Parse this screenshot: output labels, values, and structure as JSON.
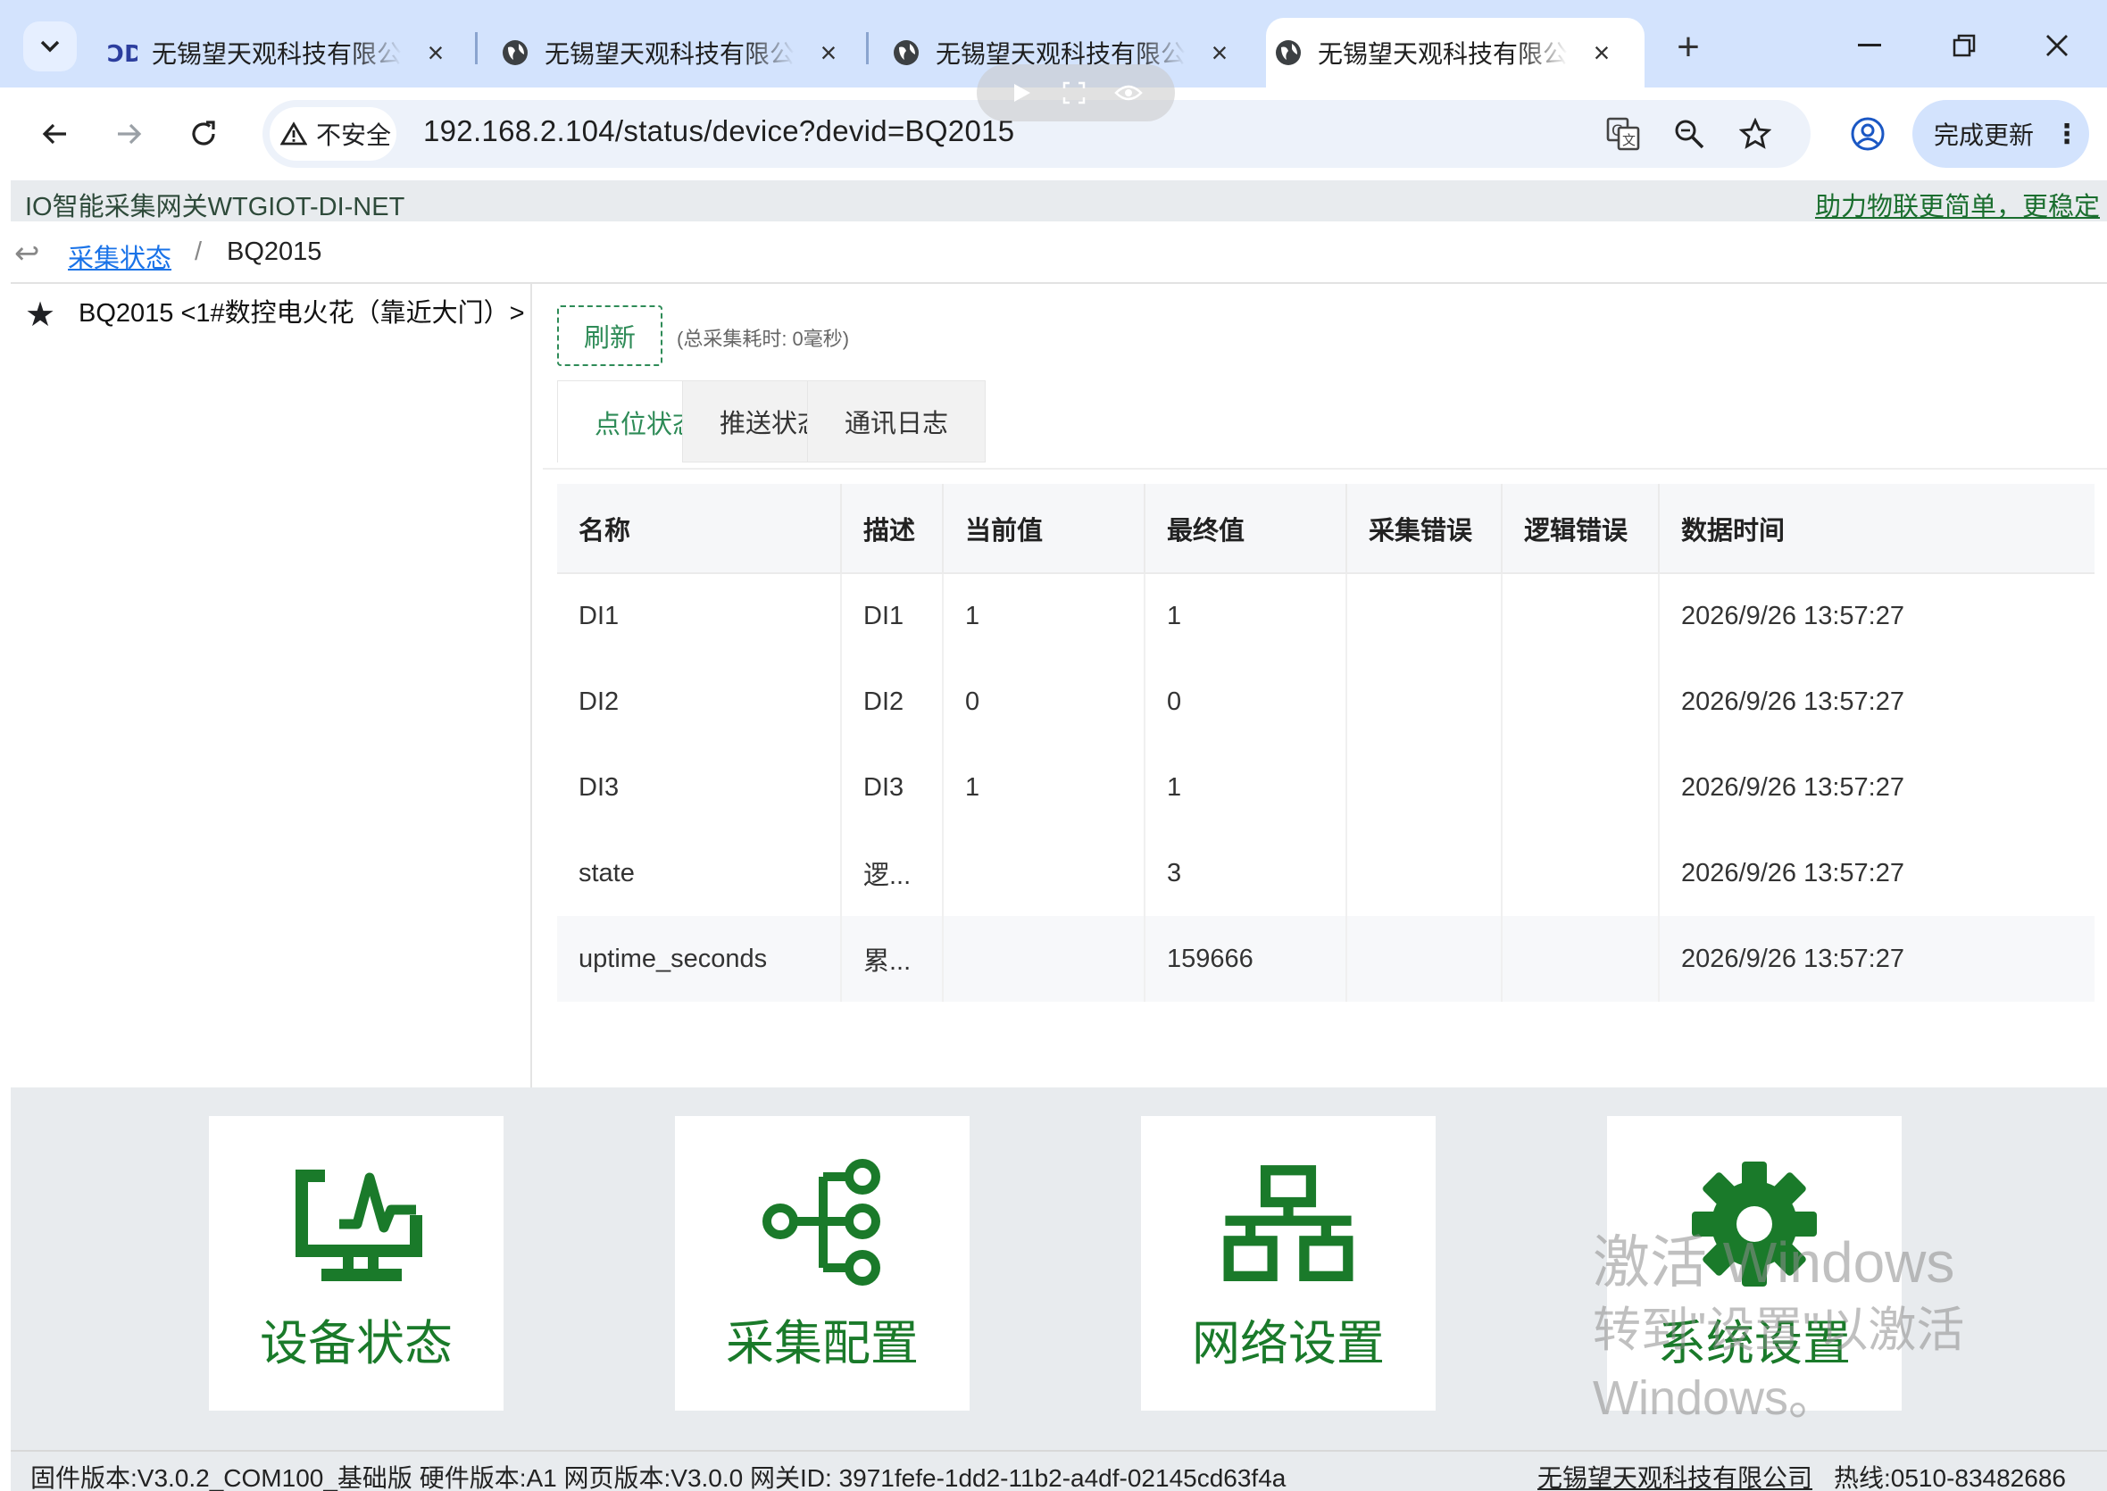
{
  "browser": {
    "tabs": [
      {
        "title": "无锡望天观科技有限公司",
        "active": false
      },
      {
        "title": "无锡望天观科技有限公司",
        "active": false
      },
      {
        "title": "无锡望天观科技有限公司",
        "active": false
      },
      {
        "title": "无锡望天观科技有限公司",
        "active": true
      }
    ],
    "security_label": "不安全",
    "url": "192.168.2.104/status/device?devid=BQ2015",
    "update_label": "完成更新"
  },
  "header": {
    "brand": "IO智能采集网关WTGIOT-DI-NET",
    "slogan": "助力物联更简单，更稳定"
  },
  "breadcrumb": {
    "link": "采集状态",
    "separator": "/",
    "current": "BQ2015"
  },
  "sidebar": {
    "device": "BQ2015 <1#数控电火花（靠近大门）>"
  },
  "toolbar": {
    "refresh_label": "刷新",
    "timing": "(总采集耗时: 0毫秒)"
  },
  "tabs": [
    "点位状态",
    "推送状态",
    "通讯日志"
  ],
  "table": {
    "columns": [
      "名称",
      "描述",
      "当前值",
      "最终值",
      "采集错误",
      "逻辑错误",
      "数据时间"
    ],
    "rows": [
      {
        "name": "DI1",
        "desc": "DI1",
        "current": "1",
        "final": "1",
        "collect_err": "",
        "logic_err": "",
        "time": "2026/9/26 13:57:27"
      },
      {
        "name": "DI2",
        "desc": "DI2",
        "current": "0",
        "final": "0",
        "collect_err": "",
        "logic_err": "",
        "time": "2026/9/26 13:57:27"
      },
      {
        "name": "DI3",
        "desc": "DI3",
        "current": "1",
        "final": "1",
        "collect_err": "",
        "logic_err": "",
        "time": "2026/9/26 13:57:27"
      },
      {
        "name": "state",
        "desc": "逻...",
        "current": "",
        "final": "3",
        "collect_err": "",
        "logic_err": "",
        "time": "2026/9/26 13:57:27"
      },
      {
        "name": "uptime_seconds",
        "desc": "累...",
        "current": "",
        "final": "159666",
        "collect_err": "",
        "logic_err": "",
        "time": "2026/9/26 13:57:27"
      }
    ]
  },
  "tiles": [
    {
      "label": "设备状态",
      "icon": "monitor-pulse-icon"
    },
    {
      "label": "采集配置",
      "icon": "node-tree-icon"
    },
    {
      "label": "网络设置",
      "icon": "network-icon"
    },
    {
      "label": "系统设置",
      "icon": "gear-icon"
    }
  ],
  "watermark": {
    "line1": "激活 Windows",
    "line2": "转到\"设置\"以激活",
    "line3": "Windows。"
  },
  "footer": {
    "versions": "固件版本:V3.0.2_COM100_基础版  硬件版本:A1  网页版本:V3.0.0  网关ID: 3971fefe-1dd2-11b2-a4df-02145cd63f4a",
    "company": "无锡望天观科技有限公司",
    "hotline": "热线:0510-83482686"
  },
  "colors": {
    "accent": "#2e8b57",
    "tile_icon": "#1a7a2a",
    "tab_strip": "#d3e3fd"
  }
}
